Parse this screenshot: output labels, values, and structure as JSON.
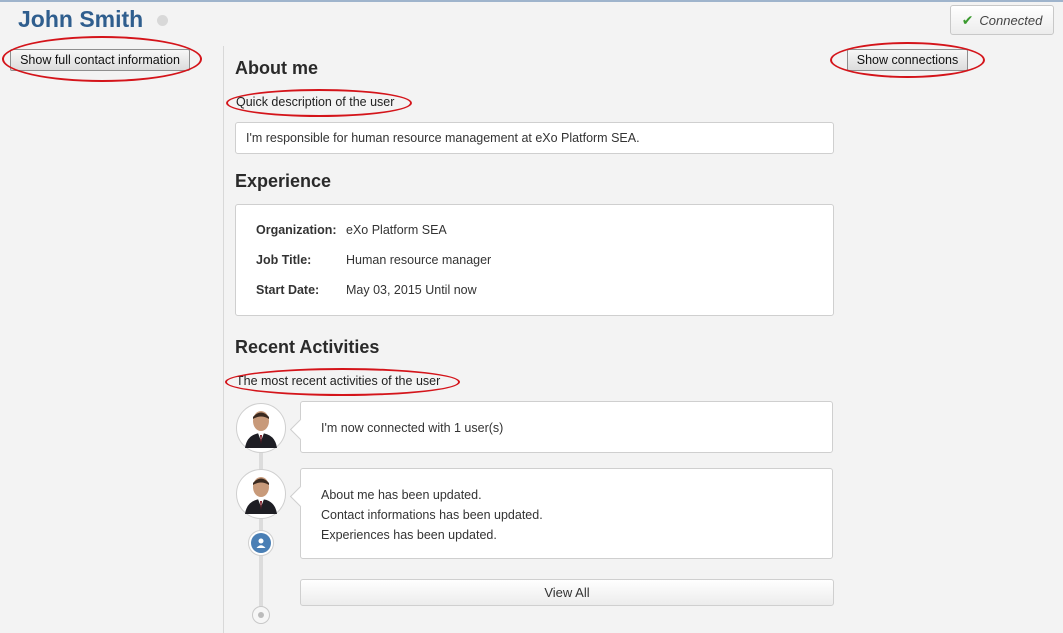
{
  "profile": {
    "name": "John Smith",
    "status_label": "Connected"
  },
  "buttons": {
    "contact_info": "Show full contact information",
    "connections": "Show connections",
    "view_all": "View All"
  },
  "about": {
    "heading": "About me",
    "hint": "Quick description of the user",
    "text": "I'm responsible for human resource management at eXo Platform SEA."
  },
  "experience": {
    "heading": "Experience",
    "rows": [
      {
        "label": "Organization:",
        "value": "eXo Platform SEA"
      },
      {
        "label": "Job Title:",
        "value": "Human resource manager"
      },
      {
        "label": "Start Date:",
        "value": "May 03, 2015 Until now"
      }
    ]
  },
  "activities": {
    "heading": "Recent Activities",
    "hint": "The most recent activities of the user",
    "items": [
      {
        "lines": [
          "I'm now connected with 1 user(s)"
        ]
      },
      {
        "lines": [
          "About me has been updated.",
          "Contact informations has been updated.",
          "Experiences has been updated."
        ]
      }
    ]
  },
  "icons": {
    "status": "status-dot-icon",
    "check": "check-icon",
    "avatar": "avatar-image",
    "user": "user-icon",
    "timeline_end": "timeline-end-icon"
  },
  "colors": {
    "name": "#2f5e8e",
    "annotation": "#d4141a",
    "check": "#3a9a2e",
    "user_badge": "#4a7fb5"
  }
}
